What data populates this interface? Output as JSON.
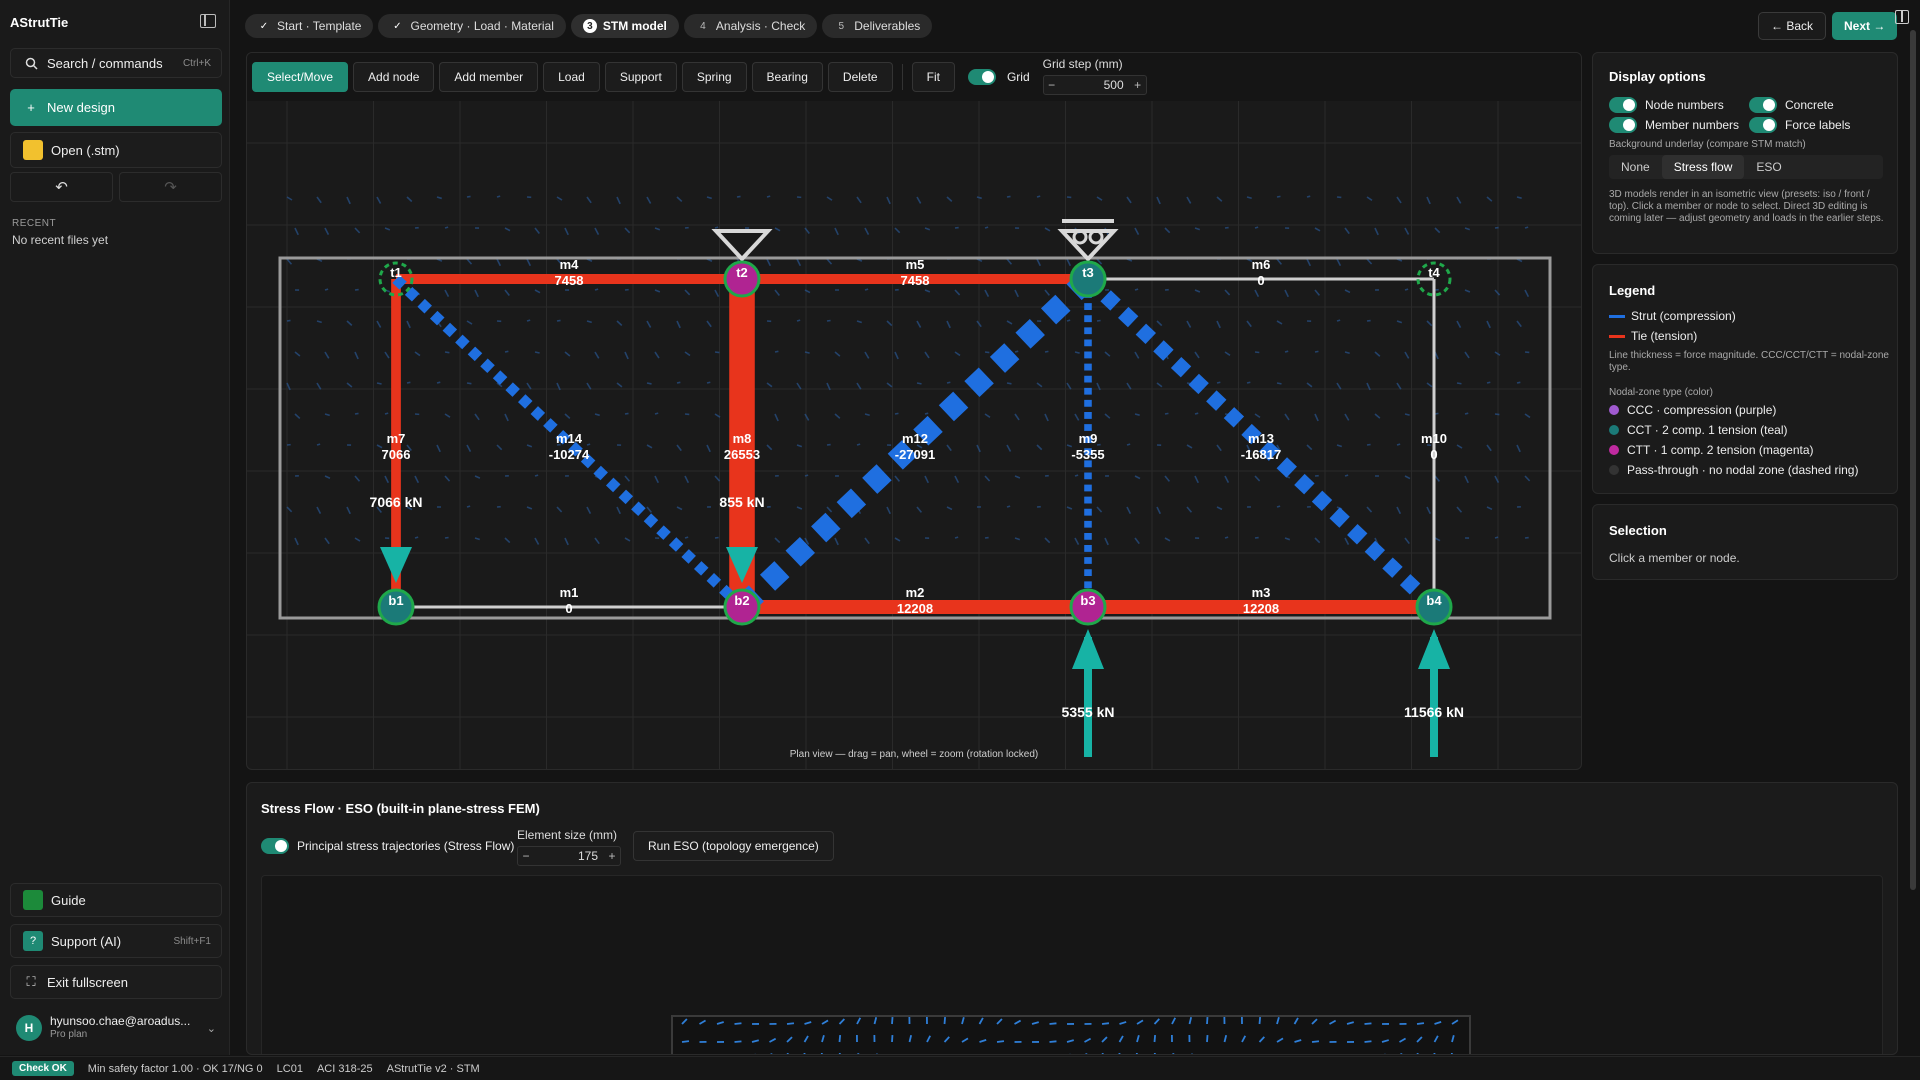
{
  "app": {
    "title": "AStrutTie"
  },
  "sidebar": {
    "search_label": "Search / commands",
    "search_shortcut": "Ctrl+K",
    "new_design": "New design",
    "open": "Open (.stm)",
    "recent_heading": "RECENT",
    "recent_empty": "No recent files yet",
    "guide": "Guide",
    "support": "Support (AI)",
    "support_shortcut": "Shift+F1",
    "exit_fullscreen": "Exit fullscreen",
    "user_initial": "H",
    "user_email": "hyunsoo.chae@aroadus...",
    "user_plan": "Pro plan"
  },
  "steps": [
    {
      "num": "✓",
      "label": "Start · Template",
      "state": "done"
    },
    {
      "num": "✓",
      "label": "Geometry · Load · Material",
      "state": "done"
    },
    {
      "num": "3",
      "label": "STM model",
      "state": "active"
    },
    {
      "num": "4",
      "label": "Analysis · Check",
      "state": "todo"
    },
    {
      "num": "5",
      "label": "Deliverables",
      "state": "todo"
    }
  ],
  "nav": {
    "back": "← Back",
    "next": "Next →"
  },
  "toolbar": {
    "tools": [
      "Select/Move",
      "Add node",
      "Add member",
      "Load",
      "Support",
      "Spring",
      "Bearing",
      "Delete"
    ],
    "fit": "Fit",
    "grid": "Grid",
    "grid_step_label": "Grid step (mm)",
    "grid_step_value": "500",
    "minus": "−",
    "plus": "+"
  },
  "canvas": {
    "hint": "Plan view — drag = pan, wheel = zoom (rotation locked)",
    "colors": {
      "tie": "#e8341c",
      "strut": "#1f6fe0",
      "ccc": "#c02aa0",
      "cct": "#1b7a78",
      "ctt": "#b02492",
      "load": "#17b3a5",
      "box": "#9a9a9a"
    },
    "nodes": [
      {
        "id": "t1",
        "x": 0,
        "y": 1,
        "type": "pass"
      },
      {
        "id": "t2",
        "x": 1,
        "y": 1,
        "type": "ctt"
      },
      {
        "id": "t3",
        "x": 2,
        "y": 1,
        "type": "cct"
      },
      {
        "id": "t4",
        "x": 3,
        "y": 1,
        "type": "pass"
      },
      {
        "id": "b1",
        "x": 0,
        "y": 0,
        "type": "cct"
      },
      {
        "id": "b2",
        "x": 1,
        "y": 0,
        "type": "ctt"
      },
      {
        "id": "b3",
        "x": 2,
        "y": 0,
        "type": "ctt"
      },
      {
        "id": "b4",
        "x": 3,
        "y": 0,
        "type": "cct"
      }
    ],
    "members": [
      {
        "id": "m1",
        "from": "b1",
        "to": "b2",
        "force": "0"
      },
      {
        "id": "m2",
        "from": "b2",
        "to": "b3",
        "force": "12208"
      },
      {
        "id": "m3",
        "from": "b3",
        "to": "b4",
        "force": "12208"
      },
      {
        "id": "m4",
        "from": "t1",
        "to": "t2",
        "force": "7458"
      },
      {
        "id": "m5",
        "from": "t2",
        "to": "t3",
        "force": "7458"
      },
      {
        "id": "m6",
        "from": "t3",
        "to": "t4",
        "force": "0"
      },
      {
        "id": "m7",
        "from": "t1",
        "to": "b1",
        "force": "7066"
      },
      {
        "id": "m8",
        "from": "t2",
        "to": "b2",
        "force": "26553"
      },
      {
        "id": "m9",
        "from": "t3",
        "to": "b3",
        "force": "-5355"
      },
      {
        "id": "m10",
        "from": "t4",
        "to": "b4",
        "force": "0"
      },
      {
        "id": "m12",
        "from": "b2",
        "to": "t3",
        "force": "-27091"
      },
      {
        "id": "m13",
        "from": "t3",
        "to": "b4",
        "force": "-16817"
      },
      {
        "id": "m14",
        "from": "t1",
        "to": "b2",
        "force": "-10274"
      }
    ],
    "loads": [
      {
        "at": "b1",
        "label": "7066 kN",
        "dir": "down"
      },
      {
        "at": "b2",
        "label": "855 kN",
        "dir": "down"
      },
      {
        "at": "b3",
        "label": "5355 kN",
        "dir": "up"
      },
      {
        "at": "b4",
        "label": "11566 kN",
        "dir": "up"
      }
    ],
    "supports": [
      {
        "at": "t2",
        "kind": "pin"
      },
      {
        "at": "t3",
        "kind": "roller"
      }
    ]
  },
  "display": {
    "title": "Display options",
    "node_numbers": "Node numbers",
    "concrete": "Concrete",
    "member_numbers": "Member numbers",
    "force_labels": "Force labels",
    "underlay_label": "Background underlay (compare STM match)",
    "underlay_options": [
      "None",
      "Stress flow",
      "ESO"
    ],
    "underlay_selected": "Stress flow",
    "note": "3D models render in an isometric view (presets: iso / front / top). Click a member or node to select. Direct 3D editing is coming later — adjust geometry and loads in the earlier steps."
  },
  "legend": {
    "title": "Legend",
    "strut": "Strut (compression)",
    "tie": "Tie (tension)",
    "thickness_note": "Line thickness = force magnitude. CCC/CCT/CTT = nodal-zone type.",
    "nodal_heading": "Nodal-zone type (color)",
    "ccc": "CCC · compression (purple)",
    "cct": "CCT · 2 comp. 1 tension (teal)",
    "ctt": "CTT · 1 comp. 2 tension (magenta)",
    "pass": "Pass-through · no nodal zone (dashed ring)"
  },
  "selection": {
    "title": "Selection",
    "hint": "Click a member or node."
  },
  "eso": {
    "title": "Stress Flow · ESO (built-in plane-stress FEM)",
    "toggle_label": "Principal stress trajectories (Stress Flow)",
    "element_size_label": "Element size (mm)",
    "element_size_value": "175",
    "run_button": "Run ESO (topology emergence)"
  },
  "status": {
    "badge": "Check OK",
    "summary": "Min safety factor 1.00 · OK 17/NG 0",
    "lc": "LC01",
    "code": "ACI 318-25",
    "version": "AStrutTie v2 · STM"
  }
}
